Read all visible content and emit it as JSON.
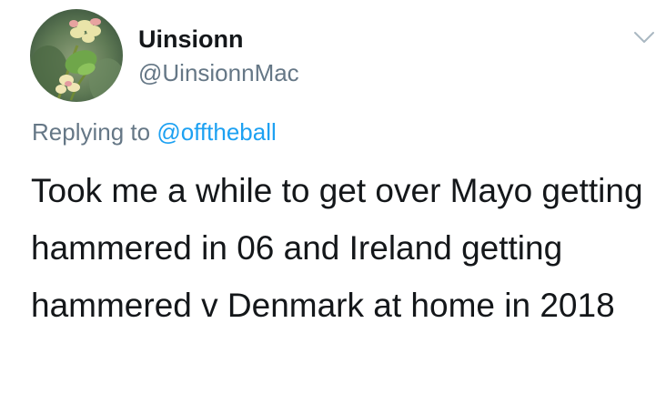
{
  "tweet": {
    "display_name": "Uinsionn",
    "handle": "@UinsionnMac",
    "reply_prefix": "Replying to",
    "reply_handle": "@offtheball",
    "text": "Took me a while to get over Mayo getting hammered in 06 and Ireland getting hammered v Denmark at home in 2018",
    "icons": {
      "avatar": "flowers-avatar",
      "menu": "chevron-down-icon"
    }
  },
  "colors": {
    "primary_text": "#14171a",
    "secondary_text": "#657786",
    "link": "#1da1f2",
    "caret": "#aab8c2"
  }
}
